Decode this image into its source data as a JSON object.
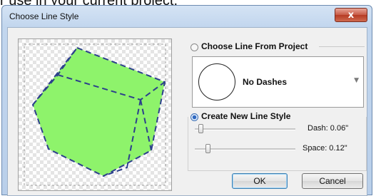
{
  "background": {
    "caption": "r use in your current project."
  },
  "window": {
    "title": "Choose Line Style",
    "close_glyph": "x"
  },
  "from_project": {
    "label": "Choose Line From Project",
    "selected": false,
    "dropdown_value": "No Dashes"
  },
  "new_style": {
    "label": "Create New Line Style",
    "selected": true,
    "dash": {
      "label": "Dash: 0.06\"",
      "value": 0.06
    },
    "space": {
      "label": "Space: 0.12\"",
      "value": 0.12
    }
  },
  "buttons": {
    "ok": "OK",
    "cancel": "Cancel"
  },
  "colors": {
    "fill": "#8ef36b",
    "dash_line": "#2c3f8c",
    "accent": "#3c6fb4"
  }
}
